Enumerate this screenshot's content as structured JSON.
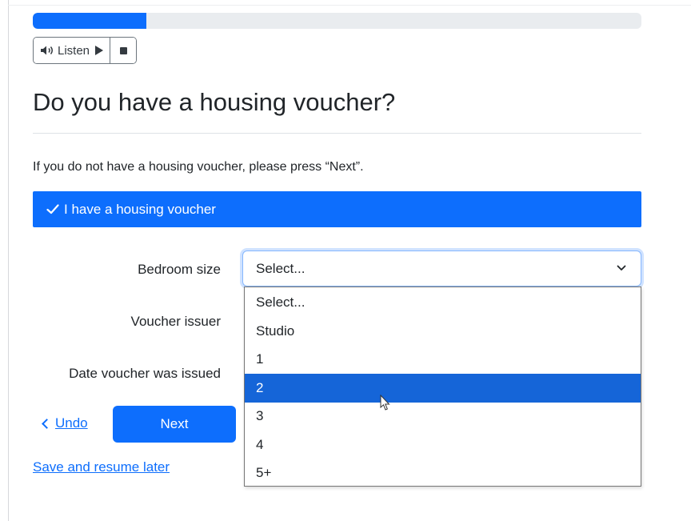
{
  "progress": {
    "fraction": 0.186
  },
  "audio": {
    "listen_label": "Listen"
  },
  "page": {
    "title": "Do you have a housing voucher?",
    "subtitle": "If you do not have a housing voucher, please press “Next”."
  },
  "voucher_checkbox": {
    "label": "I have a housing voucher",
    "checked": true
  },
  "fields": {
    "bedroom_size": {
      "label": "Bedroom size",
      "value": "Select...",
      "options": [
        "Select...",
        "Studio",
        "1",
        "2",
        "3",
        "4",
        "5+"
      ],
      "highlighted": "2"
    },
    "voucher_issuer": {
      "label": "Voucher issuer"
    },
    "date_issued": {
      "label": "Date voucher was issued"
    }
  },
  "nav": {
    "undo_label": "Undo",
    "next_label": "Next",
    "save_label": "Save and resume later"
  },
  "colors": {
    "primary": "#0d6efd",
    "highlight": "#1565d8"
  }
}
